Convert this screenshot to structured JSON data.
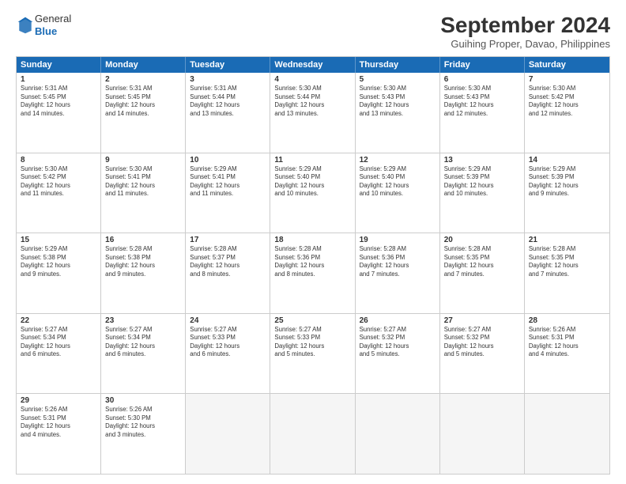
{
  "logo": {
    "general": "General",
    "blue": "Blue"
  },
  "title": "September 2024",
  "subtitle": "Guihing Proper, Davao, Philippines",
  "header": {
    "days": [
      "Sunday",
      "Monday",
      "Tuesday",
      "Wednesday",
      "Thursday",
      "Friday",
      "Saturday"
    ]
  },
  "rows": [
    [
      {
        "day": "",
        "content": "",
        "empty": true
      },
      {
        "day": "2",
        "content": "Sunrise: 5:31 AM\nSunset: 5:45 PM\nDaylight: 12 hours\nand 14 minutes."
      },
      {
        "day": "3",
        "content": "Sunrise: 5:31 AM\nSunset: 5:44 PM\nDaylight: 12 hours\nand 13 minutes."
      },
      {
        "day": "4",
        "content": "Sunrise: 5:30 AM\nSunset: 5:44 PM\nDaylight: 12 hours\nand 13 minutes."
      },
      {
        "day": "5",
        "content": "Sunrise: 5:30 AM\nSunset: 5:43 PM\nDaylight: 12 hours\nand 13 minutes."
      },
      {
        "day": "6",
        "content": "Sunrise: 5:30 AM\nSunset: 5:43 PM\nDaylight: 12 hours\nand 12 minutes."
      },
      {
        "day": "7",
        "content": "Sunrise: 5:30 AM\nSunset: 5:42 PM\nDaylight: 12 hours\nand 12 minutes."
      }
    ],
    [
      {
        "day": "8",
        "content": "Sunrise: 5:30 AM\nSunset: 5:42 PM\nDaylight: 12 hours\nand 11 minutes."
      },
      {
        "day": "9",
        "content": "Sunrise: 5:30 AM\nSunset: 5:41 PM\nDaylight: 12 hours\nand 11 minutes."
      },
      {
        "day": "10",
        "content": "Sunrise: 5:29 AM\nSunset: 5:41 PM\nDaylight: 12 hours\nand 11 minutes."
      },
      {
        "day": "11",
        "content": "Sunrise: 5:29 AM\nSunset: 5:40 PM\nDaylight: 12 hours\nand 10 minutes."
      },
      {
        "day": "12",
        "content": "Sunrise: 5:29 AM\nSunset: 5:40 PM\nDaylight: 12 hours\nand 10 minutes."
      },
      {
        "day": "13",
        "content": "Sunrise: 5:29 AM\nSunset: 5:39 PM\nDaylight: 12 hours\nand 10 minutes."
      },
      {
        "day": "14",
        "content": "Sunrise: 5:29 AM\nSunset: 5:39 PM\nDaylight: 12 hours\nand 9 minutes."
      }
    ],
    [
      {
        "day": "15",
        "content": "Sunrise: 5:29 AM\nSunset: 5:38 PM\nDaylight: 12 hours\nand 9 minutes."
      },
      {
        "day": "16",
        "content": "Sunrise: 5:28 AM\nSunset: 5:38 PM\nDaylight: 12 hours\nand 9 minutes."
      },
      {
        "day": "17",
        "content": "Sunrise: 5:28 AM\nSunset: 5:37 PM\nDaylight: 12 hours\nand 8 minutes."
      },
      {
        "day": "18",
        "content": "Sunrise: 5:28 AM\nSunset: 5:36 PM\nDaylight: 12 hours\nand 8 minutes."
      },
      {
        "day": "19",
        "content": "Sunrise: 5:28 AM\nSunset: 5:36 PM\nDaylight: 12 hours\nand 7 minutes."
      },
      {
        "day": "20",
        "content": "Sunrise: 5:28 AM\nSunset: 5:35 PM\nDaylight: 12 hours\nand 7 minutes."
      },
      {
        "day": "21",
        "content": "Sunrise: 5:28 AM\nSunset: 5:35 PM\nDaylight: 12 hours\nand 7 minutes."
      }
    ],
    [
      {
        "day": "22",
        "content": "Sunrise: 5:27 AM\nSunset: 5:34 PM\nDaylight: 12 hours\nand 6 minutes."
      },
      {
        "day": "23",
        "content": "Sunrise: 5:27 AM\nSunset: 5:34 PM\nDaylight: 12 hours\nand 6 minutes."
      },
      {
        "day": "24",
        "content": "Sunrise: 5:27 AM\nSunset: 5:33 PM\nDaylight: 12 hours\nand 6 minutes."
      },
      {
        "day": "25",
        "content": "Sunrise: 5:27 AM\nSunset: 5:33 PM\nDaylight: 12 hours\nand 5 minutes."
      },
      {
        "day": "26",
        "content": "Sunrise: 5:27 AM\nSunset: 5:32 PM\nDaylight: 12 hours\nand 5 minutes."
      },
      {
        "day": "27",
        "content": "Sunrise: 5:27 AM\nSunset: 5:32 PM\nDaylight: 12 hours\nand 5 minutes."
      },
      {
        "day": "28",
        "content": "Sunrise: 5:26 AM\nSunset: 5:31 PM\nDaylight: 12 hours\nand 4 minutes."
      }
    ],
    [
      {
        "day": "29",
        "content": "Sunrise: 5:26 AM\nSunset: 5:31 PM\nDaylight: 12 hours\nand 4 minutes."
      },
      {
        "day": "30",
        "content": "Sunrise: 5:26 AM\nSunset: 5:30 PM\nDaylight: 12 hours\nand 3 minutes."
      },
      {
        "day": "",
        "content": "",
        "empty": true
      },
      {
        "day": "",
        "content": "",
        "empty": true
      },
      {
        "day": "",
        "content": "",
        "empty": true
      },
      {
        "day": "",
        "content": "",
        "empty": true
      },
      {
        "day": "",
        "content": "",
        "empty": true
      }
    ]
  ],
  "row0_day1": {
    "day": "1",
    "content": "Sunrise: 5:31 AM\nSunset: 5:45 PM\nDaylight: 12 hours\nand 14 minutes."
  }
}
